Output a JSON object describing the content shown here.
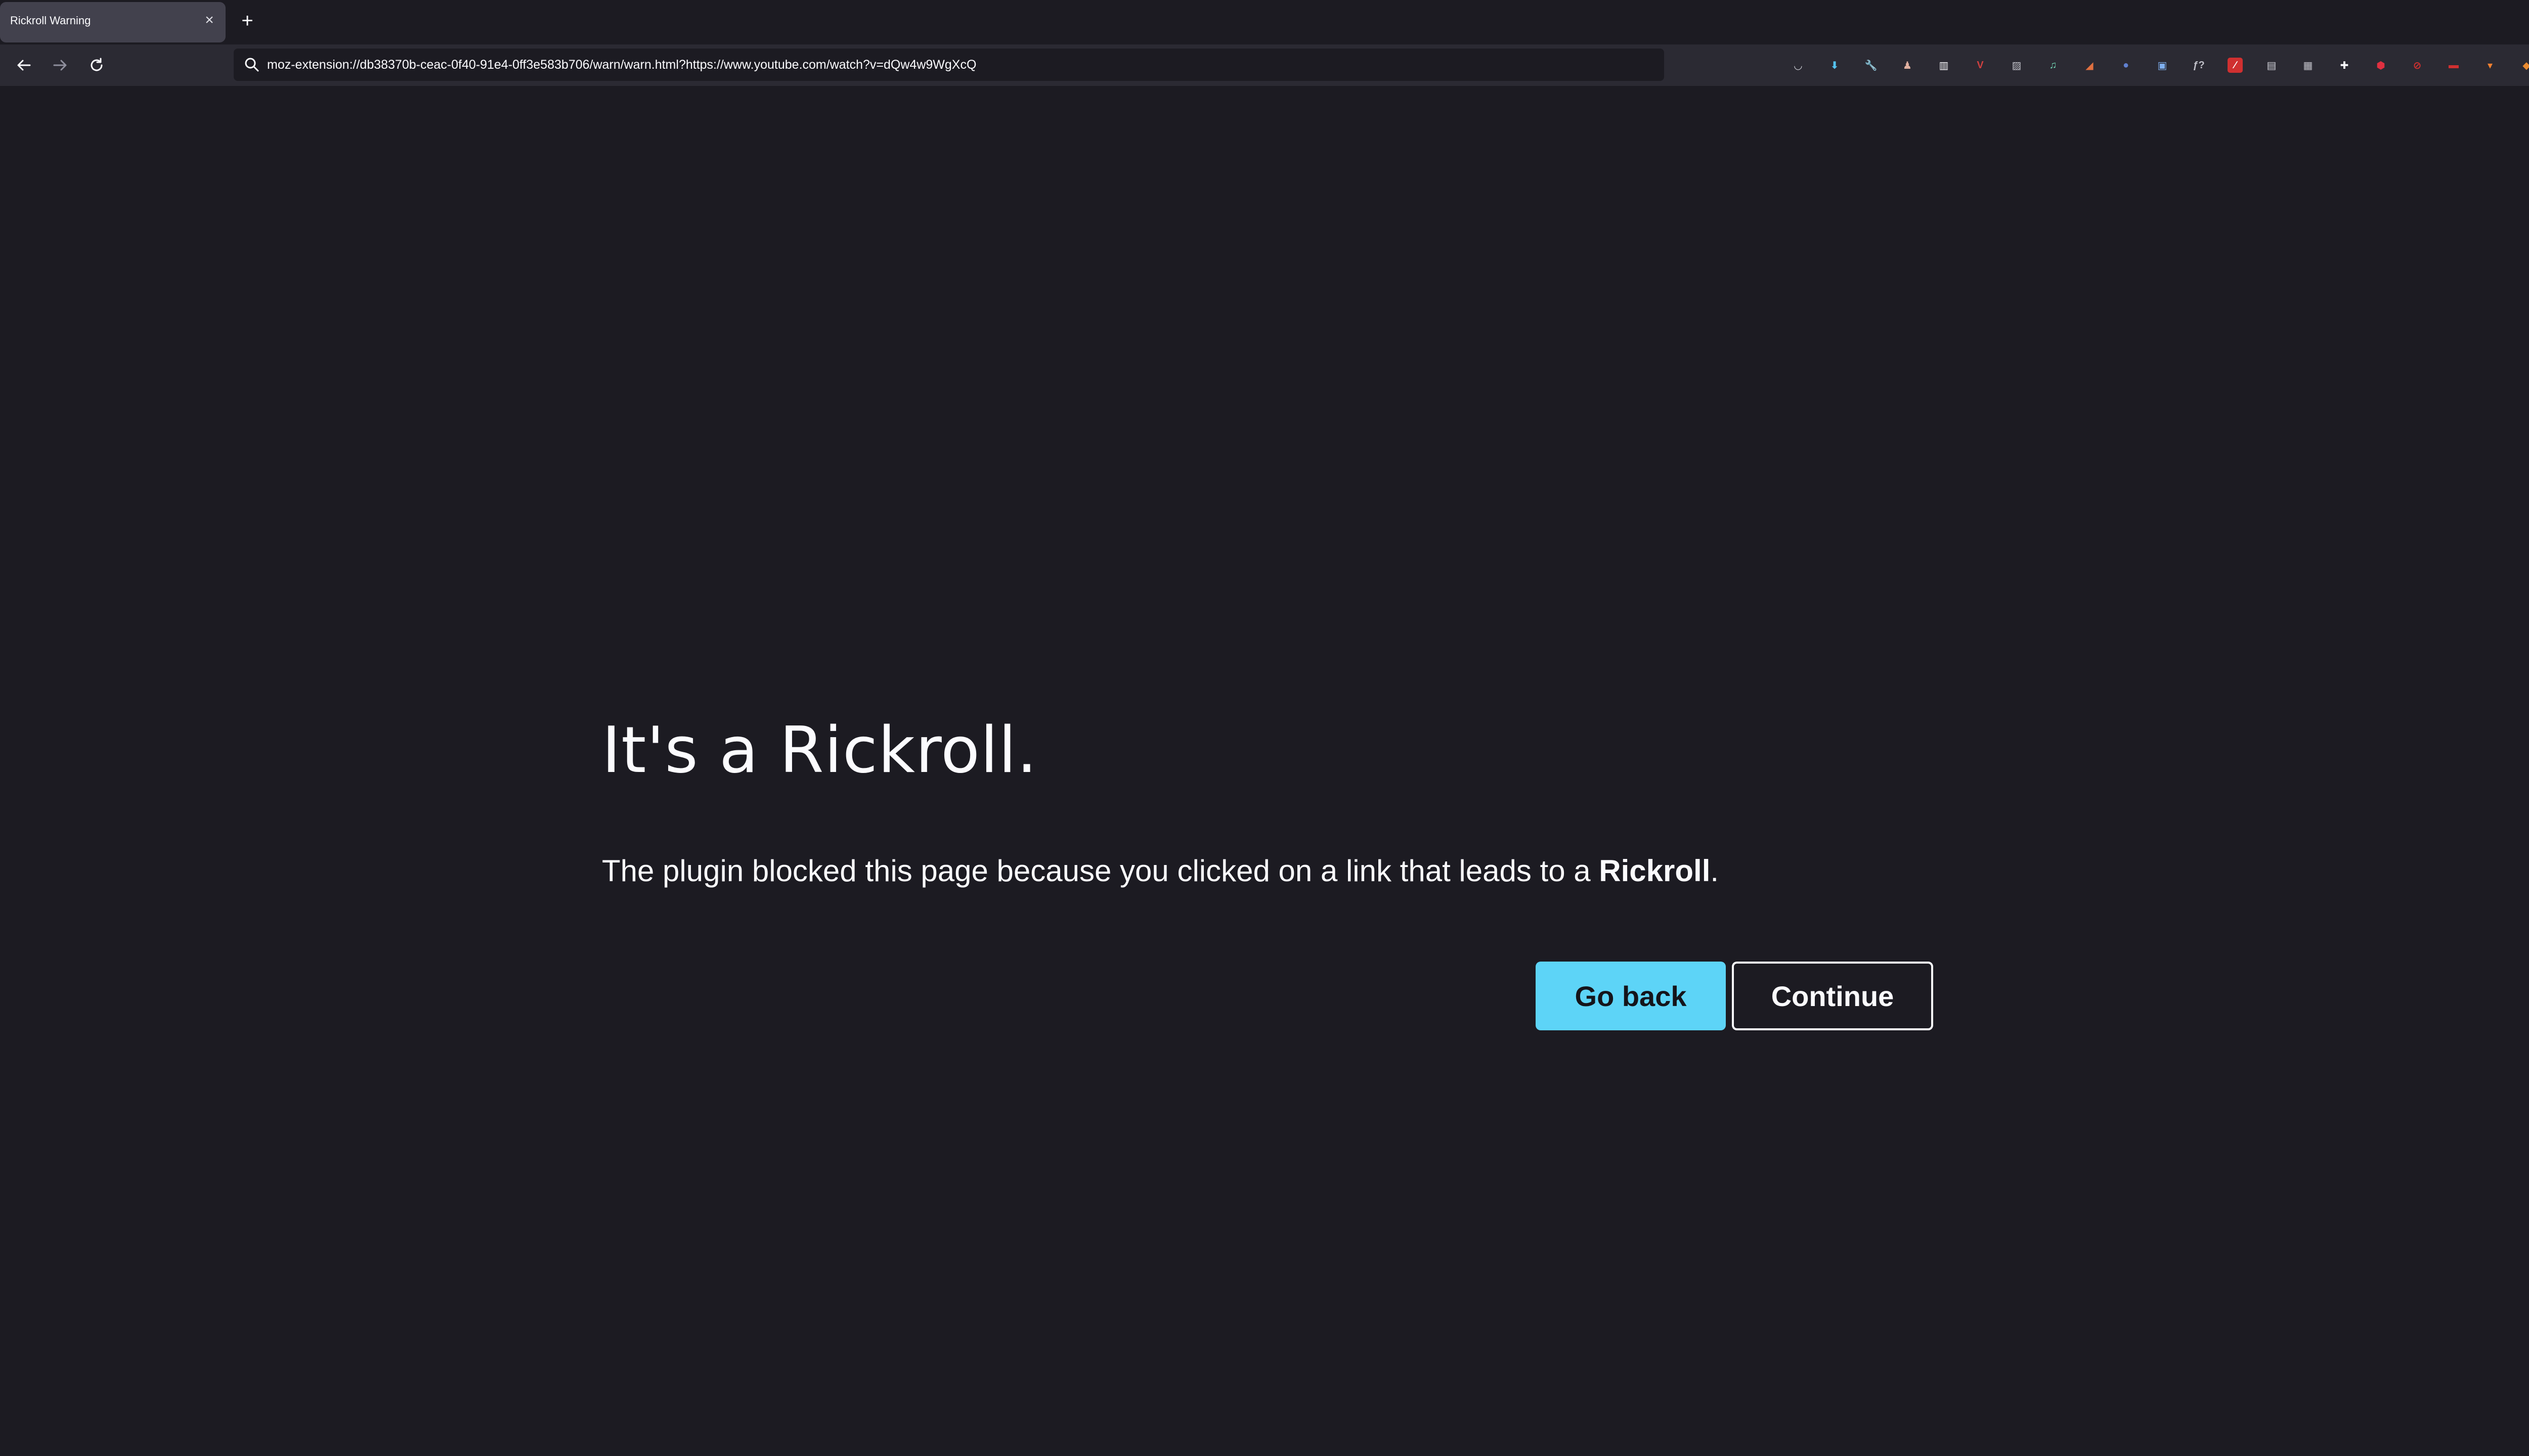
{
  "tab": {
    "title": "Rickroll Warning",
    "close_glyph": "×"
  },
  "new_tab_glyph": "+",
  "urlbar": {
    "url": "moz-extension://db38370b-ceac-0f40-91e4-0ff3e583b706/warn/warn.html?https://www.youtube.com/watch?v=dQw4w9WgXcQ"
  },
  "extensions": [
    {
      "name": "pocket-icon",
      "glyph": "◡",
      "color": "#d0d0d8",
      "bg": "transparent"
    },
    {
      "name": "downloads-icon",
      "glyph": "⬇",
      "color": "#54c3f0",
      "bg": "transparent"
    },
    {
      "name": "wrench-icon",
      "glyph": "🔧",
      "color": "#fbfbfe",
      "bg": "transparent"
    },
    {
      "name": "extension-figure-icon",
      "glyph": "♟",
      "color": "#e0b0a0",
      "bg": "transparent"
    },
    {
      "name": "library-icon",
      "glyph": "▥",
      "color": "#fbfbfe",
      "bg": "transparent"
    },
    {
      "name": "vue-devtools-icon",
      "glyph": "V",
      "color": "#d04040",
      "bg": "transparent"
    },
    {
      "name": "image-extension-icon",
      "glyph": "▨",
      "color": "#c0c0c8",
      "bg": "transparent"
    },
    {
      "name": "music-extension-icon",
      "glyph": "♫",
      "color": "#70d0b0",
      "bg": "transparent"
    },
    {
      "name": "code-extension-icon",
      "glyph": "◢",
      "color": "#e07040",
      "bg": "transparent"
    },
    {
      "name": "round-blue-extension-icon",
      "glyph": "●",
      "color": "#6080d0",
      "bg": "transparent"
    },
    {
      "name": "windows-extension-icon",
      "glyph": "▣",
      "color": "#7fb0f0",
      "bg": "transparent"
    },
    {
      "name": "font-extension-icon",
      "glyph": "ƒ?",
      "color": "#c0c0c8",
      "bg": "transparent"
    },
    {
      "name": "red-square-extension-icon",
      "glyph": "∕",
      "color": "#ffffff",
      "bg": "#d03030"
    },
    {
      "name": "gray-square-extension-icon",
      "glyph": "▤",
      "color": "#d0d0d8",
      "bg": "transparent"
    },
    {
      "name": "stack-extension-icon",
      "glyph": "▦",
      "color": "#c0c0c8",
      "bg": "transparent"
    },
    {
      "name": "puzzle-icon",
      "glyph": "✚",
      "color": "#fbfbfe",
      "bg": "transparent"
    },
    {
      "name": "red-shield-extension-icon",
      "glyph": "⬢",
      "color": "#e03040",
      "bg": "transparent"
    },
    {
      "name": "red-circle-extension-icon",
      "glyph": "⊘",
      "color": "#d03030",
      "bg": "transparent"
    },
    {
      "name": "red-bar-extension-icon",
      "glyph": "▬",
      "color": "#d03030",
      "bg": "transparent"
    },
    {
      "name": "orange-cup-extension-icon",
      "glyph": "▾",
      "color": "#f08030",
      "bg": "transparent"
    },
    {
      "name": "metamask-icon",
      "glyph": "◆",
      "color": "#e88a30",
      "bg": "transparent"
    }
  ],
  "page": {
    "heading": "It's a Rickroll.",
    "message_prefix": "The plugin blocked this page because you clicked on a link that leads to a ",
    "message_strong": "Rickroll",
    "message_suffix": ".",
    "go_back_label": "Go back",
    "continue_label": "Continue"
  },
  "colors": {
    "background": "#1c1b22",
    "toolbar": "#2b2a33",
    "accent": "#5dd4f7"
  }
}
